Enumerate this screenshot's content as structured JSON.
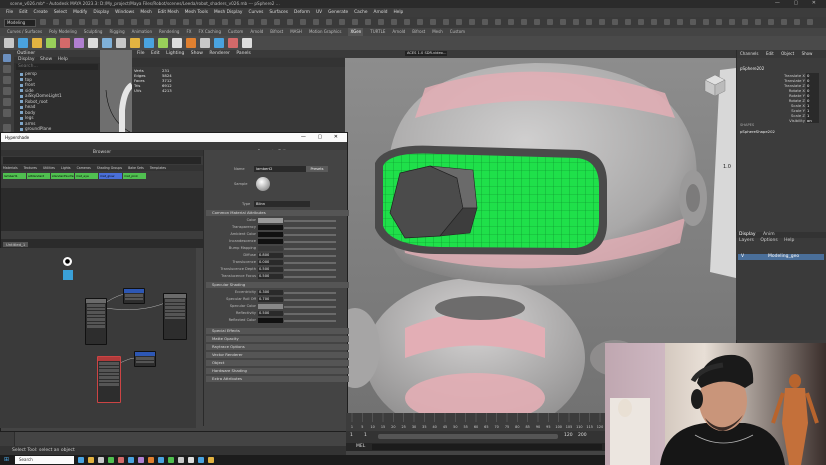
{
  "app": {
    "title": "scene_v026.mb* - Autodesk MAYA 2023.3: D:/My_project/Maya Files/Robot/scenes/Leeda/robot_shaders_v026.mb --- pSphere2 ...",
    "menus": [
      "File",
      "Edit",
      "Create",
      "Select",
      "Modify",
      "Display",
      "Windows",
      "Mesh",
      "Edit Mesh",
      "Mesh Tools",
      "Mesh Display",
      "Curves",
      "Surfaces",
      "Deform",
      "UV",
      "Generate",
      "Cache",
      "Arnold",
      "Help"
    ],
    "workspace_selector": "Modeling",
    "shelf_tabs": [
      "Curves / Surfaces",
      "Poly Modeling",
      "Sculpting",
      "Rigging",
      "Animation",
      "Rendering",
      "FX",
      "FX Caching",
      "Custom",
      "Arnold",
      "Bifrost",
      "MASH",
      "Motion Graphics",
      "XGen",
      "TURTLE",
      "Arnold",
      "Bifrost",
      "Mesh",
      "Custom"
    ],
    "active_shelf_tab": "XGen",
    "shelf_icon_colors": [
      "#c8c8c8",
      "#4aa3df",
      "#e3b341",
      "#9ad05a",
      "#d36a6a",
      "#b07fd1",
      "#ddd",
      "#7fb0d8",
      "#c8c8c8",
      "#e3b341",
      "#4aa3df",
      "#9ad05a",
      "#ddd",
      "#e08030",
      "#c8c8c8",
      "#4aa3df",
      "#d36a6a",
      "#ddd"
    ]
  },
  "outliner": {
    "title": "Outliner",
    "menus": [
      "Display",
      "Show",
      "Help"
    ],
    "items": [
      "persp",
      "top",
      "front",
      "side",
      "aiSkyDomeLight1",
      "Robot_root",
      "head",
      "body",
      "legs",
      "arms",
      "groundPlane"
    ],
    "search_placeholder": "Search..."
  },
  "channel_table": {
    "menus": [
      "File",
      "Edit",
      "Lighting",
      "Show",
      "Renderer",
      "Panels"
    ],
    "rows": [
      "Verts",
      "Edges",
      "Faces",
      "Tris",
      "UVs"
    ],
    "values": [
      "231",
      "5824",
      "3712",
      "6912",
      "4213"
    ]
  },
  "viewport": {
    "camera": "persp",
    "camera_field": "ACES 1.0 SDR-video (sRGB)",
    "label": "persp"
  },
  "channel_box": {
    "menus": [
      "Channels",
      "Edit",
      "Object",
      "Show"
    ],
    "object": "pSphere202",
    "attrs": [
      {
        "name": "Translate X",
        "value": "0"
      },
      {
        "name": "Translate Y",
        "value": "0"
      },
      {
        "name": "Translate Z",
        "value": "0"
      },
      {
        "name": "Rotate X",
        "value": "0"
      },
      {
        "name": "Rotate Y",
        "value": "0"
      },
      {
        "name": "Rotate Z",
        "value": "0"
      },
      {
        "name": "Scale X",
        "value": "1"
      },
      {
        "name": "Scale Y",
        "value": "1"
      },
      {
        "name": "Scale Z",
        "value": "1"
      },
      {
        "name": "Visibility",
        "value": "on"
      }
    ],
    "shape_label": "SHAPES",
    "shape_name": "pSphereShape202"
  },
  "hypershade": {
    "title": "Hypershade",
    "browser_label": "Browser",
    "browser_tabs": [
      "Materials",
      "Textures",
      "Utilities",
      "Lights",
      "Cameras",
      "Shading Groups",
      "Bake Sets",
      "Templates"
    ],
    "material_swatches": [
      {
        "name": "lambert1",
        "color": "#50c050"
      },
      {
        "name": "aiStandard",
        "color": "#50c050"
      },
      {
        "name": "standardSurface",
        "color": "#50c050"
      },
      {
        "name": "mat_eye",
        "color": "#50c050"
      },
      {
        "name": "mat_glow",
        "color": "#4a6fd8"
      },
      {
        "name": "mat_pink",
        "color": "#50c050"
      }
    ],
    "graph_tab": "Untitled_1",
    "property_editor_title": "Property Editor",
    "prop_material_name": "green_glow",
    "name_label": "Name",
    "name_value": "lambert2",
    "presets_label": "Presets",
    "section_common": "Common Material Attributes",
    "props": [
      {
        "label": "Color",
        "value": ""
      },
      {
        "label": "Transparency",
        "value": ""
      },
      {
        "label": "Ambient Color",
        "value": ""
      },
      {
        "label": "Incandescence",
        "value": ""
      },
      {
        "label": "Bump Mapping",
        "value": ""
      },
      {
        "label": "Diffuse",
        "value": "0.800"
      },
      {
        "label": "Translucence",
        "value": "0.000"
      },
      {
        "label": "Translucence Depth",
        "value": "0.500"
      },
      {
        "label": "Translucence Focus",
        "value": "0.500"
      }
    ],
    "section_specular": "Specular Shading",
    "spec_props": [
      {
        "label": "Eccentricity",
        "value": "0.300"
      },
      {
        "label": "Specular Roll Off",
        "value": "0.700"
      },
      {
        "label": "Specular Color",
        "value": ""
      },
      {
        "label": "Reflectivity",
        "value": "0.500"
      },
      {
        "label": "Reflected Color",
        "value": ""
      }
    ],
    "collapsed_sections": [
      "Special Effects",
      "Matte Opacity",
      "Raytrace Options",
      "Vector Renderer",
      "Object",
      "Hardware Shading",
      "Extra Attributes"
    ],
    "type_label": "Type",
    "type_value": "Blinn",
    "sample_label": "Sample"
  },
  "layers": {
    "tabs": [
      "Display",
      "Anim"
    ],
    "menus": [
      "Layers",
      "Options",
      "Help"
    ],
    "items": [
      {
        "name": "Modeling_geo",
        "vis": "V"
      }
    ]
  },
  "timeline": {
    "ticks": [
      "1",
      "5",
      "10",
      "15",
      "20",
      "25",
      "30",
      "35",
      "40",
      "45",
      "50",
      "55",
      "60",
      "65",
      "70",
      "75",
      "80",
      "85",
      "90",
      "95",
      "100",
      "105",
      "110",
      "115",
      "120"
    ],
    "start": "1",
    "end": "120",
    "range_start": "1",
    "range_end": "200",
    "fps": "24 fps"
  },
  "mel_label": "MEL",
  "help_line": "Select Tool: select an object",
  "taskbar": {
    "search_placeholder": "Search",
    "icon_colors": [
      "#4aa3df",
      "#e3b341",
      "#c8c8c8",
      "#50c050",
      "#d36a6a",
      "#4aa3df",
      "#b07fd1",
      "#e08030",
      "#4aa3df",
      "#50c050",
      "#c8c8c8",
      "#ddd",
      "#4aa3df",
      "#e3b341"
    ]
  },
  "colors": {
    "eye_green": "#1fe04a",
    "robot_pink": "#e3aeb5",
    "robot_grey": "#b9b9b9",
    "swatch_green": "#50c050"
  }
}
